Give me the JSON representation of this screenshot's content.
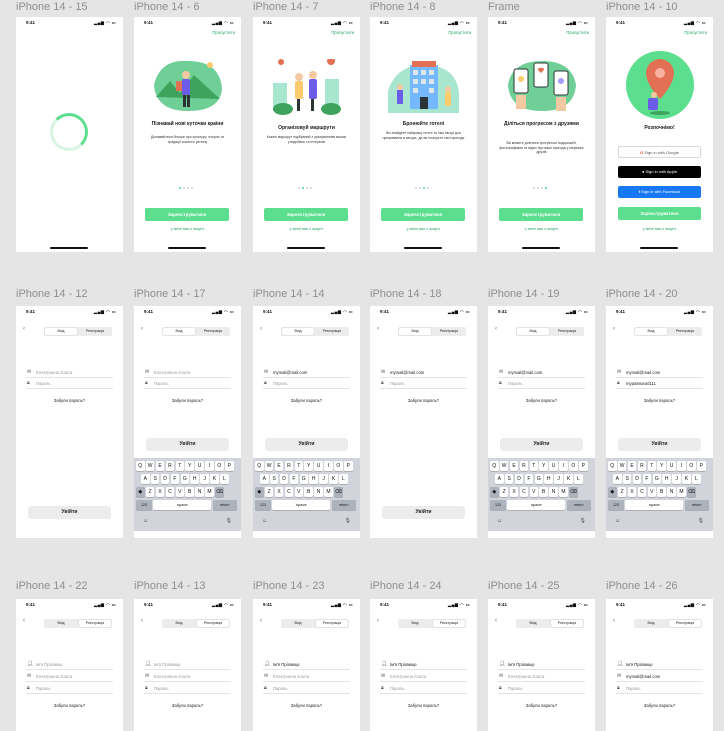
{
  "status_time": "9:41",
  "status_icons": "▂▄▆ ◠ ▭",
  "frames": [
    "iPhone 14 - 15",
    "iPhone 14 - 6",
    "iPhone 14 - 7",
    "iPhone 14 - 8",
    "Frame",
    "iPhone 14 - 10",
    "iPhone 14 - 12",
    "iPhone 14 - 17",
    "iPhone 14 - 14",
    "iPhone 14 - 18",
    "iPhone 14 - 19",
    "iPhone 14 - 20",
    "iPhone 14 - 22",
    "iPhone 14 - 13",
    "iPhone 14 - 23",
    "iPhone 14 - 24",
    "iPhone 14 - 25",
    "iPhone 14 - 26"
  ],
  "onboarding": {
    "skip": "Пропустити",
    "signup": "Зареєструватися",
    "login_link": "у мене вже є акаунт",
    "slides": [
      {
        "title": "Пізнавай нові куточки країни",
        "desc": "Дізнавайтеся більше про культуру, історію та традиції кожного регіону"
      },
      {
        "title": "Організовуй маршрути",
        "desc": "Кожен маршрут підібраний з урахуванням ваших уподобань та інтересів"
      },
      {
        "title": "Бронюйте готелі",
        "desc": "Ви знайдете найкращі готелі та інші місця для проживання в місцях, де ви плануєте свої пригоди"
      },
      {
        "title": "Діліться прогресом з друзями",
        "desc": "Ви можете ділитися прогресом подорожей, фотографіями та відео про ваші пригоди у мережах друзів"
      }
    ]
  },
  "welcome": {
    "title": "Розпочнімо!",
    "google": "Sign in with Google",
    "apple": "Sign in with Apple",
    "facebook": "Sign in with Facebook",
    "signup": "Зареєструватися",
    "login_link": "у мене вже є акаунт"
  },
  "auth": {
    "tab_login": "Вхід",
    "tab_register": "Реєстрація",
    "name_placeholder": "Ім'я Прізвище",
    "name_value": "Ім'я Прізвище",
    "email_placeholder": "Електронна пошта",
    "email_value": "mymail@mail.com",
    "password_placeholder": "Пароль",
    "password_value": "mypassword111",
    "forgot": "Забули пароль?",
    "login_button": "Увійти"
  },
  "keyboard": {
    "row1": [
      "Q",
      "W",
      "E",
      "R",
      "T",
      "Y",
      "U",
      "I",
      "O",
      "P"
    ],
    "row2": [
      "A",
      "S",
      "D",
      "F",
      "G",
      "H",
      "J",
      "K",
      "L"
    ],
    "row3": [
      "Z",
      "X",
      "C",
      "V",
      "B",
      "N",
      "M"
    ],
    "shift": "◆",
    "delete": "⌫",
    "numbers": "123",
    "space": "space",
    "return": "return",
    "emoji": "☺",
    "mic": "🎙"
  },
  "colors": {
    "accent": "#5bde8d",
    "accent_text": "#22a566",
    "facebook": "#1877f2"
  }
}
